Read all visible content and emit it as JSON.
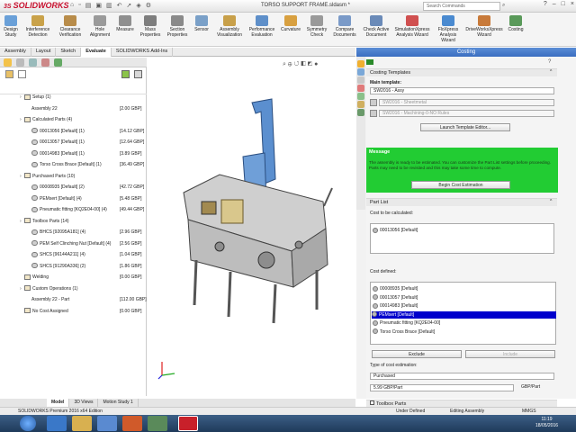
{
  "app": {
    "logo": "SOLIDWORKS",
    "logo_mark": "3S",
    "title": "TORSO SUPPORT FRAME.sldasm *",
    "search_placeholder": "Search Commands"
  },
  "window_controls": [
    "?",
    "–",
    "□",
    "×"
  ],
  "ribbon": {
    "buttons": [
      {
        "label": "Design\nStudy",
        "icon": "design-study-icon",
        "color": "#6aa0d8"
      },
      {
        "label": "Interference\nDetection",
        "icon": "interference-icon",
        "color": "#c9a24a"
      },
      {
        "label": "Clearance\nVerification",
        "icon": "clearance-icon",
        "color": "#b88c4a"
      },
      {
        "label": "Hole\nAlignment",
        "icon": "hole-alignment-icon",
        "color": "#9a9a9a"
      },
      {
        "label": "Measure",
        "icon": "measure-icon",
        "color": "#8f8f8f"
      },
      {
        "label": "Mass\nProperties",
        "icon": "mass-properties-icon",
        "color": "#7e7e7e"
      },
      {
        "label": "Section\nProperties",
        "icon": "section-properties-icon",
        "color": "#8a8a8a"
      },
      {
        "label": "Sensor",
        "icon": "sensor-icon",
        "color": "#7aa0c8"
      },
      {
        "label": "Assembly\nVisualization",
        "icon": "assembly-visualization-icon",
        "color": "#c8a04a"
      },
      {
        "label": "Performance\nEvaluation",
        "icon": "performance-icon",
        "color": "#5e8fc9"
      },
      {
        "label": "Curvature",
        "icon": "curvature-icon",
        "color": "#d8a040"
      },
      {
        "label": "Symmetry\nCheck",
        "icon": "symmetry-icon",
        "color": "#9a9a9a"
      },
      {
        "label": "Compare\nDocuments",
        "icon": "compare-icon",
        "color": "#7a9ac8"
      },
      {
        "label": "Check Active\nDocument",
        "icon": "check-document-icon",
        "color": "#6a8ab8"
      },
      {
        "label": "SimulationXpress\nAnalysis Wizard",
        "icon": "simulationxpress-icon",
        "color": "#d05050"
      },
      {
        "label": "FloXpress\nAnalysis\nWizard",
        "icon": "floxpress-icon",
        "color": "#4a8ad0"
      },
      {
        "label": "DriveWorksXpress\nWizard",
        "icon": "driveworks-icon",
        "color": "#c87a3a"
      },
      {
        "label": "Costing",
        "icon": "costing-icon",
        "color": "#5a9a5a"
      }
    ]
  },
  "command_tabs": [
    "Assembly",
    "Layout",
    "Sketch",
    "Evaluate",
    "SOLIDWORKS Add-Ins"
  ],
  "active_command_tab": "Evaluate",
  "tree": {
    "rows": [
      {
        "label": "Setup (1)",
        "price": "",
        "level": 0,
        "icon": "folder"
      },
      {
        "label": "Assembly 22",
        "price": "[2.00 GBP]",
        "level": 1,
        "icon": "none"
      },
      {
        "label": "Calculated Parts (4)",
        "price": "",
        "level": 0,
        "icon": "folder"
      },
      {
        "label": "00013056 [Default] (1)",
        "price": "[14.12 GBP]",
        "level": 1,
        "icon": "part"
      },
      {
        "label": "00013057 [Default] (1)",
        "price": "[12.64 GBP]",
        "level": 1,
        "icon": "part"
      },
      {
        "label": "00014983 [Default] (1)",
        "price": "[3.89 GBP]",
        "level": 1,
        "icon": "part"
      },
      {
        "label": "Torso Cross Brace [Default] (1)",
        "price": "[36.49 GBP]",
        "level": 1,
        "icon": "part"
      },
      {
        "label": "Purchased Parts (10)",
        "price": "",
        "level": 0,
        "icon": "folder"
      },
      {
        "label": "00008935 [Default] (2)",
        "price": "[42.72 GBP]",
        "level": 1,
        "icon": "part"
      },
      {
        "label": "PEMsert [Default] (4)",
        "price": "[5.48 GBP]",
        "level": 1,
        "icon": "part"
      },
      {
        "label": "Pneumatic fitting [KQ2E04-00] (4)",
        "price": "[49.44 GBP]",
        "level": 1,
        "icon": "part"
      },
      {
        "label": "Toolbox Parts (14)",
        "price": "",
        "level": 0,
        "icon": "folder"
      },
      {
        "label": "BHCS [92095A181] (4)",
        "price": "[2.96 GBP]",
        "level": 1,
        "icon": "part"
      },
      {
        "label": "PEM Self Clinching Nut [Default] (4)",
        "price": "[2.56 GBP]",
        "level": 1,
        "icon": "part"
      },
      {
        "label": "SHCS [96144A211] (4)",
        "price": "[1.04 GBP]",
        "level": 1,
        "icon": "part"
      },
      {
        "label": "SHCS [91290A336] (2)",
        "price": "[1.86 GBP]",
        "level": 1,
        "icon": "part"
      },
      {
        "label": "Welding",
        "price": "[0.00 GBP]",
        "level": 0,
        "icon": "folder"
      },
      {
        "label": "Custom Operations (1)",
        "price": "",
        "level": 0,
        "icon": "folder"
      },
      {
        "label": "Assembly 22 - Part",
        "price": "[112.00 GBP]",
        "level": 1,
        "icon": "none"
      },
      {
        "label": "No Cost Assigned",
        "price": "[0.00 GBP]",
        "level": 0,
        "icon": "folder"
      }
    ]
  },
  "right_panel": {
    "title": "Costing",
    "costing_templates": {
      "header": "Costing Templates",
      "main_template_label": "Main template:",
      "main_template_value": "SW2016 - Assy",
      "sub_templates": [
        "SW2016 - Sheetmetal",
        "SW2016 - Machining-0-NO Rules"
      ],
      "launch_button": "Launch Template Editor..."
    },
    "message": {
      "header": "Message",
      "text": "The assembly is ready to be estimated. You can customize the Part List settings before proceeding. Parts may need to be revisited and this may take some time to compute.",
      "button": "Begin Cost Estimation"
    },
    "part_list": {
      "header": "Part List",
      "to_calc_label": "Cost to be calculated:",
      "to_calc_items": [
        "00013056 [Default]"
      ],
      "defined_label": "Cost defined:",
      "defined_items": [
        "00008935 [Default]",
        "00013057 [Default]",
        "00014983 [Default]",
        "PEMsert [Default]",
        "Pneumatic fitting [KQ2E04-00]",
        "Torso Cross Brace [Default]"
      ],
      "selected_index": 3,
      "exclude_button": "Exclude",
      "include_button": "Include",
      "type_label": "Type of cost estimation:",
      "type_value": "Purchased",
      "cost_value": "5.99",
      "cost_unit": "GBP/Part",
      "cost_unit_right": "GBP/Part"
    },
    "toolbox_header": "Toolbox Parts"
  },
  "bottom_tabs": [
    "Model",
    "3D Views",
    "Motion Study 1"
  ],
  "status": {
    "edition": "SOLIDWORKS Premium 2016 x64 Edition",
    "state": "Under Defined",
    "mode": "Editing Assembly",
    "units": "MMGS"
  },
  "taskbar": {
    "time": "11:19",
    "date": "18/05/2016"
  }
}
